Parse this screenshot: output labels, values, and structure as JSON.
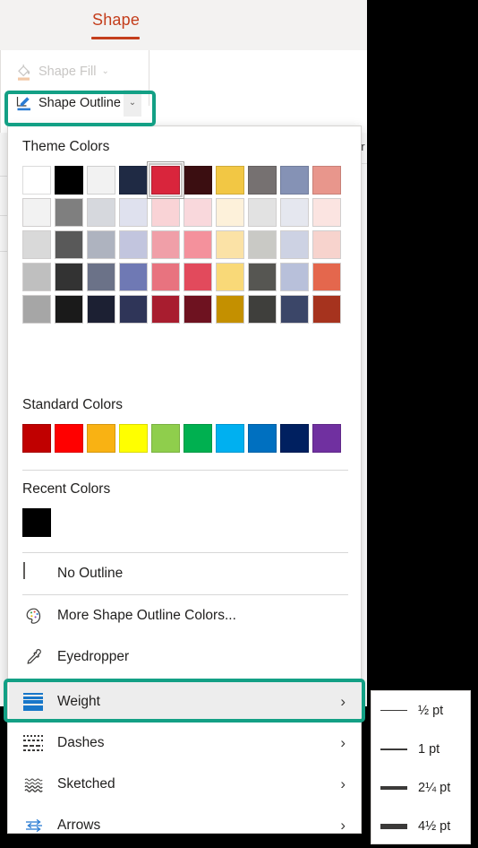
{
  "ribbon": {
    "active_tab": "Shape",
    "accent_color": "#c43e1c",
    "buttons": [
      {
        "label": "Shape Fill",
        "icon": "fill-bucket-icon",
        "chevron": "⌄",
        "disabled": true
      },
      {
        "label": "Shape Outline",
        "icon": "outline-pen-icon",
        "chevron": "⌄",
        "disabled": false
      }
    ]
  },
  "highlight": {
    "color": "#13a085",
    "targets": [
      "Shape Outline",
      "Weight"
    ]
  },
  "background": {
    "cut_off_text": "ar"
  },
  "dropdown": {
    "sections": {
      "theme": {
        "title": "Theme Colors",
        "selected_index": 4,
        "rows": [
          [
            "#ffffff",
            "#000000",
            "#f2f2f2",
            "#1f2a44",
            "#d9253c",
            "#3b0e11",
            "#f2c council",
            "#767171",
            "#8592b5",
            "#e8968c"
          ],
          [
            "#f2f2f2",
            "#7f7f7f",
            "#d6d8dd",
            "#dfe1ee",
            "#f9d3d6",
            "#f9d8dc",
            "#fdf1da",
            "#e2e2e2",
            "#e5e7ef",
            "#fbe4e1"
          ],
          [
            "#d9d9d9",
            "#595959",
            "#aeb3bf",
            "#c2c5de",
            "#f09fa8",
            "#f4919c",
            "#fbe2a6",
            "#c9c9c5",
            "#cdd2e3",
            "#f7d3cd"
          ],
          [
            "#bfbfbf",
            "#333333",
            "#6b7288",
            "#6f79b4",
            "#e8737f",
            "#e24a5c",
            "#f9d978",
            "#565652",
            "#b8c0da",
            "#e4674d"
          ],
          [
            "#a6a6a6",
            "#1a1a1a",
            "#1c2033",
            "#2f3558",
            "#a81d2f",
            "#6e1220",
            "#c49000",
            "#3f3f3c",
            "#3b4668",
            "#a6331e"
          ]
        ]
      },
      "standard": {
        "title": "Standard Colors",
        "colors": [
          "#c00000",
          "#ff0000",
          "#f9b213",
          "#ffff00",
          "#8fce4c",
          "#00b050",
          "#00b0f0",
          "#0070c0",
          "#002060",
          "#7030a0"
        ]
      },
      "recent": {
        "title": "Recent Colors",
        "colors": [
          "#000000"
        ]
      }
    },
    "menu_items": [
      {
        "label": "No Outline",
        "icon": "no-outline-square-icon",
        "submenu": false
      },
      {
        "label": "More Shape Outline Colors...",
        "icon": "palette-icon",
        "submenu": false
      },
      {
        "label": "Eyedropper",
        "icon": "eyedropper-icon",
        "submenu": false
      },
      {
        "label": "Weight",
        "icon": "line-weight-icon",
        "submenu": true,
        "chevron": "›",
        "highlighted": true
      },
      {
        "label": "Dashes",
        "icon": "dashes-icon",
        "submenu": true,
        "chevron": "›",
        "highlighted": false
      },
      {
        "label": "Sketched",
        "icon": "sketched-icon",
        "submenu": true,
        "chevron": "›",
        "highlighted": false
      },
      {
        "label": "Arrows",
        "icon": "arrows-icon",
        "submenu": true,
        "chevron": "›",
        "highlighted": false
      }
    ]
  },
  "weight_submenu": {
    "items": [
      {
        "label": "½ pt",
        "thickness_px": 1
      },
      {
        "label": "1 pt",
        "thickness_px": 2
      },
      {
        "label": "2¼ pt",
        "thickness_px": 4
      },
      {
        "label": "4½ pt",
        "thickness_px": 6
      }
    ]
  }
}
